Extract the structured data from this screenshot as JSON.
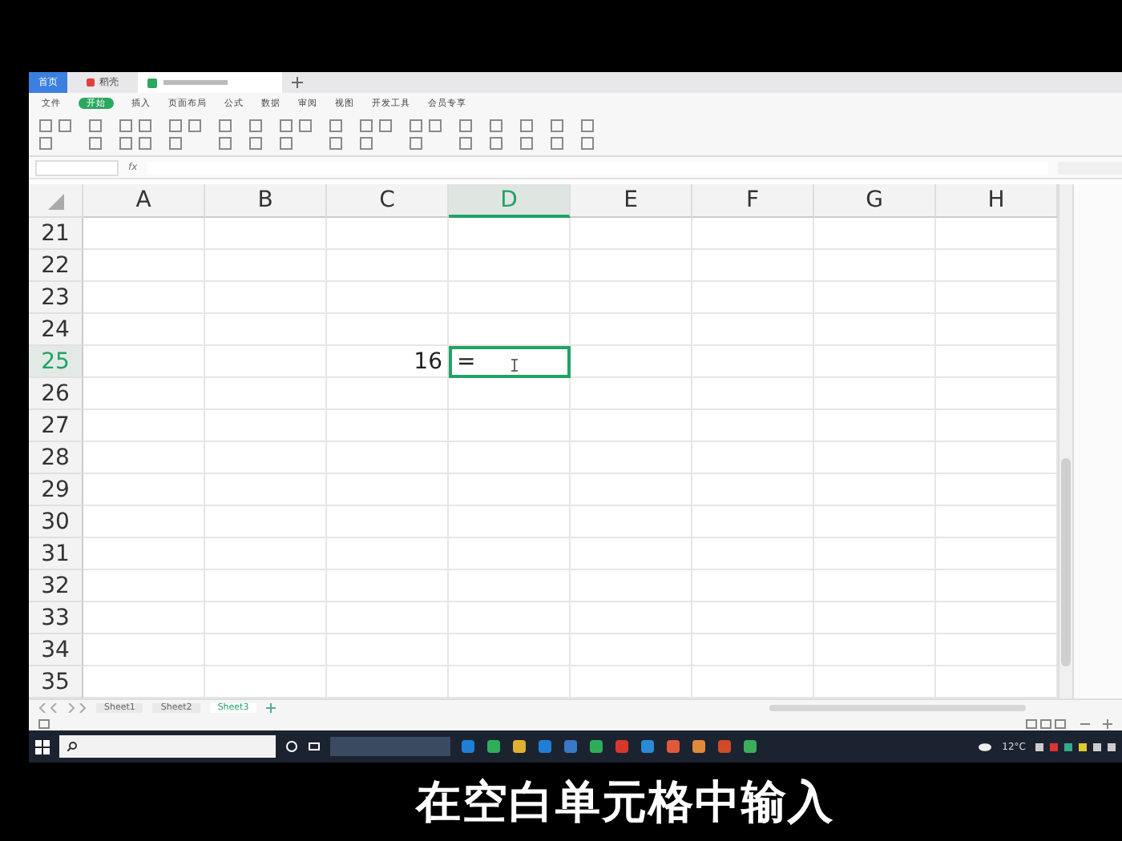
{
  "tabs": [
    {
      "label": "首页",
      "selected": false,
      "kind": "home"
    },
    {
      "label": "稻壳",
      "selected": false,
      "kind": "docer"
    },
    {
      "kind": "file",
      "selected": true
    }
  ],
  "menu": [
    {
      "label": "文件",
      "selected": false
    },
    {
      "label": "开始",
      "selected": true
    },
    {
      "label": "插入",
      "selected": false
    },
    {
      "label": "页面布局",
      "selected": false
    },
    {
      "label": "公式",
      "selected": false
    },
    {
      "label": "数据",
      "selected": false
    },
    {
      "label": "审阅",
      "selected": false
    },
    {
      "label": "视图",
      "selected": false
    },
    {
      "label": "开发工具",
      "selected": false
    },
    {
      "label": "会员专享",
      "selected": false
    }
  ],
  "formula_bar": {
    "fx": "fx"
  },
  "columns": [
    {
      "label": "A",
      "selected": false
    },
    {
      "label": "B",
      "selected": false
    },
    {
      "label": "C",
      "selected": false
    },
    {
      "label": "D",
      "selected": true
    },
    {
      "label": "E",
      "selected": false
    },
    {
      "label": "F",
      "selected": false
    },
    {
      "label": "G",
      "selected": false
    },
    {
      "label": "H",
      "selected": false
    }
  ],
  "rows": [
    {
      "number": "21",
      "selected": false,
      "cells": [
        null,
        null,
        null,
        null,
        null,
        null,
        null,
        null
      ]
    },
    {
      "number": "22",
      "selected": false,
      "cells": [
        null,
        null,
        null,
        null,
        null,
        null,
        null,
        null
      ]
    },
    {
      "number": "23",
      "selected": false,
      "cells": [
        null,
        null,
        null,
        null,
        null,
        null,
        null,
        null
      ]
    },
    {
      "number": "24",
      "selected": false,
      "cells": [
        null,
        null,
        null,
        null,
        null,
        null,
        null,
        null
      ]
    },
    {
      "number": "25",
      "selected": true,
      "cells": [
        null,
        null,
        "16",
        "=",
        null,
        null,
        null,
        null
      ]
    },
    {
      "number": "26",
      "selected": false,
      "cells": [
        null,
        null,
        null,
        null,
        null,
        null,
        null,
        null
      ]
    },
    {
      "number": "27",
      "selected": false,
      "cells": [
        null,
        null,
        null,
        null,
        null,
        null,
        null,
        null
      ]
    },
    {
      "number": "28",
      "selected": false,
      "cells": [
        null,
        null,
        null,
        null,
        null,
        null,
        null,
        null
      ]
    },
    {
      "number": "29",
      "selected": false,
      "cells": [
        null,
        null,
        null,
        null,
        null,
        null,
        null,
        null
      ]
    },
    {
      "number": "30",
      "selected": false,
      "cells": [
        null,
        null,
        null,
        null,
        null,
        null,
        null,
        null
      ]
    },
    {
      "number": "31",
      "selected": false,
      "cells": [
        null,
        null,
        null,
        null,
        null,
        null,
        null,
        null
      ]
    },
    {
      "number": "32",
      "selected": false,
      "cells": [
        null,
        null,
        null,
        null,
        null,
        null,
        null,
        null
      ]
    },
    {
      "number": "33",
      "selected": false,
      "cells": [
        null,
        null,
        null,
        null,
        null,
        null,
        null,
        null
      ]
    },
    {
      "number": "34",
      "selected": false,
      "cells": [
        null,
        null,
        null,
        null,
        null,
        null,
        null,
        null
      ]
    },
    {
      "number": "35",
      "selected": false,
      "cells": [
        null,
        null,
        null,
        null,
        null,
        null,
        null,
        null
      ]
    }
  ],
  "sheets": [
    {
      "label": "Sheet1",
      "selected": false
    },
    {
      "label": "Sheet2",
      "selected": false
    },
    {
      "label": "Sheet3",
      "selected": true
    }
  ],
  "taskbar": {
    "weather": "12°C"
  },
  "caption": "在空白单元格中输入"
}
